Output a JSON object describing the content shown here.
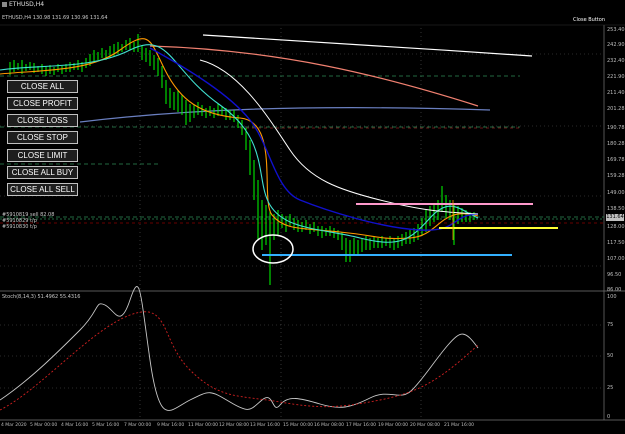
{
  "window": {
    "title": "ETHUSD,H4",
    "ohlc_line": "ETHUSD,H4 130.98 131.69 130.96 131.64",
    "close_button_label": "Close Button"
  },
  "buttons": [
    {
      "label": "CLOSE ALL"
    },
    {
      "label": "CLOSE PROFIT"
    },
    {
      "label": "CLOSE LOSS"
    },
    {
      "label": "CLOSE STOP"
    },
    {
      "label": "CLOSE LIMIT"
    },
    {
      "label": "CLOSE ALL BUY"
    },
    {
      "label": "CLOSE ALL SELL"
    }
  ],
  "price_axis": [
    "253.40",
    "242.90",
    "232.40",
    "221.90",
    "211.40",
    "201.28",
    "190.78",
    "180.28",
    "169.78",
    "159.28",
    "149.00",
    "138.50",
    "128.00",
    "117.50",
    "107.00",
    "96.50",
    "86.00"
  ],
  "price_tag": {
    "value": "131.64",
    "color": "#c0c0c0"
  },
  "order_labels": [
    "#5910819 sell 82.08",
    "#5910829 t/p",
    "#5910830 t/p"
  ],
  "indicator": {
    "label": "Stoch(8,14,3) 51.4962 55.4316",
    "levels": [
      "100",
      "75",
      "50",
      "25",
      "0"
    ]
  },
  "time_axis": [
    "4 Mar 2020",
    "5 Mar 00:00",
    "4 Mar 16:00",
    "5 Mar 16:00",
    "7 Mar 00:00",
    "9 Mar 16:00",
    "11 Mar 00:00",
    "12 Mar 08:00",
    "13 Mar 16:00",
    "15 Mar 00:00",
    "16 Mar 08:00",
    "17 Mar 16:00",
    "19 Mar 00:00",
    "20 Mar 08:00",
    "21 Mar 16:00"
  ],
  "colors": {
    "candles_up": "#00ff00",
    "candles_down": "#00ff00",
    "ma_fast": "#ff9900",
    "ma_cyan": "#40e0d0",
    "ma_blue": "#1010cc",
    "ma_white": "#ffffff",
    "ma_salmon": "#f08070",
    "ma_slate": "#6a7fc0",
    "line_pink": "#ff99cc",
    "line_yellow": "#ffff33",
    "line_lightblue": "#33b0ff",
    "stoch_main": "#c8c8c8",
    "stoch_signal": "#d02020"
  }
}
